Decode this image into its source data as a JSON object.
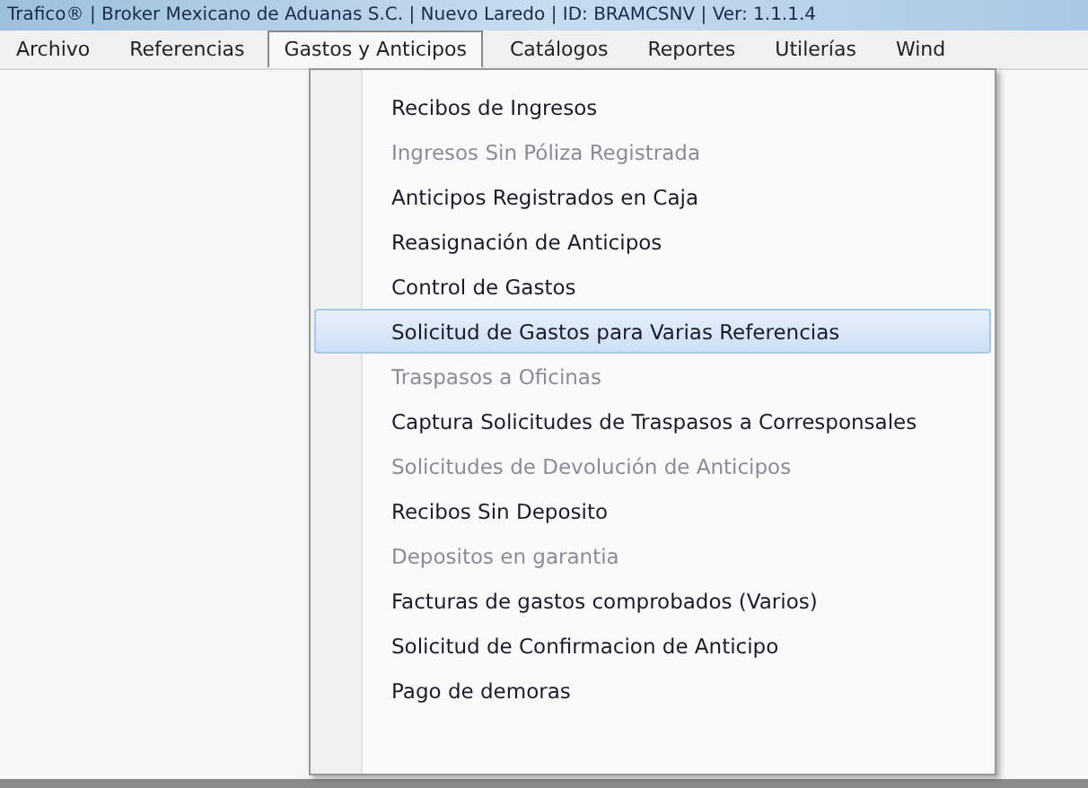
{
  "window": {
    "title": "Trafico® | Broker Mexicano de Aduanas S.C. | Nuevo Laredo | ID: BRAMCSNV | Ver: 1.1.1.4"
  },
  "menu_bar": [
    {
      "label": "Archivo",
      "selected": false
    },
    {
      "label": "Referencias",
      "selected": false
    },
    {
      "label": "Gastos y Anticipos",
      "selected": true
    },
    {
      "label": "Catálogos",
      "selected": false
    },
    {
      "label": "Reportes",
      "selected": false
    },
    {
      "label": "Utilerías",
      "selected": false
    },
    {
      "label": "Wind",
      "selected": false
    }
  ],
  "dropdown": [
    {
      "label": "Recibos de Ingresos",
      "selected": false,
      "disabled": false
    },
    {
      "label": "Ingresos Sin Póliza Registrada",
      "selected": false,
      "disabled": true
    },
    {
      "label": "Anticipos Registrados en Caja",
      "selected": false,
      "disabled": false
    },
    {
      "label": "Reasignación de Anticipos",
      "selected": false,
      "disabled": false
    },
    {
      "label": "Control de Gastos",
      "selected": false,
      "disabled": false
    },
    {
      "label": "Solicitud de Gastos para Varias Referencias",
      "selected": true,
      "disabled": false
    },
    {
      "label": "Traspasos a Oficinas",
      "selected": false,
      "disabled": true
    },
    {
      "label": "Captura Solicitudes de Traspasos a Corresponsales",
      "selected": false,
      "disabled": false
    },
    {
      "label": "Solicitudes de Devolución de Anticipos",
      "selected": false,
      "disabled": true
    },
    {
      "label": "Recibos Sin Deposito",
      "selected": false,
      "disabled": false
    },
    {
      "label": "Depositos en garantia",
      "selected": false,
      "disabled": true
    },
    {
      "label": "Facturas de gastos comprobados (Varios)",
      "selected": false,
      "disabled": false
    },
    {
      "label": "Solicitud de Confirmacion de Anticipo",
      "selected": false,
      "disabled": false
    },
    {
      "label": "Pago de demoras",
      "selected": false,
      "disabled": false
    }
  ]
}
